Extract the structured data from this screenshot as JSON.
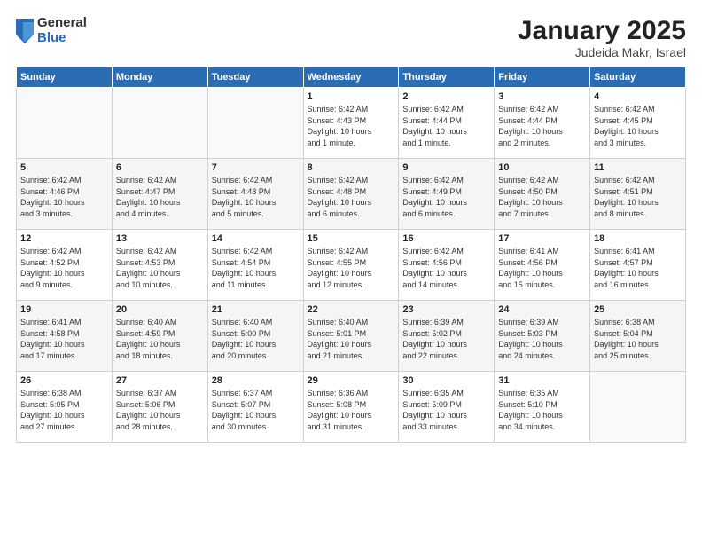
{
  "logo": {
    "general": "General",
    "blue": "Blue"
  },
  "title": "January 2025",
  "subtitle": "Judeida Makr, Israel",
  "weekdays": [
    "Sunday",
    "Monday",
    "Tuesday",
    "Wednesday",
    "Thursday",
    "Friday",
    "Saturday"
  ],
  "weeks": [
    [
      {
        "day": "",
        "info": ""
      },
      {
        "day": "",
        "info": ""
      },
      {
        "day": "",
        "info": ""
      },
      {
        "day": "1",
        "info": "Sunrise: 6:42 AM\nSunset: 4:43 PM\nDaylight: 10 hours\nand 1 minute."
      },
      {
        "day": "2",
        "info": "Sunrise: 6:42 AM\nSunset: 4:44 PM\nDaylight: 10 hours\nand 1 minute."
      },
      {
        "day": "3",
        "info": "Sunrise: 6:42 AM\nSunset: 4:44 PM\nDaylight: 10 hours\nand 2 minutes."
      },
      {
        "day": "4",
        "info": "Sunrise: 6:42 AM\nSunset: 4:45 PM\nDaylight: 10 hours\nand 3 minutes."
      }
    ],
    [
      {
        "day": "5",
        "info": "Sunrise: 6:42 AM\nSunset: 4:46 PM\nDaylight: 10 hours\nand 3 minutes."
      },
      {
        "day": "6",
        "info": "Sunrise: 6:42 AM\nSunset: 4:47 PM\nDaylight: 10 hours\nand 4 minutes."
      },
      {
        "day": "7",
        "info": "Sunrise: 6:42 AM\nSunset: 4:48 PM\nDaylight: 10 hours\nand 5 minutes."
      },
      {
        "day": "8",
        "info": "Sunrise: 6:42 AM\nSunset: 4:48 PM\nDaylight: 10 hours\nand 6 minutes."
      },
      {
        "day": "9",
        "info": "Sunrise: 6:42 AM\nSunset: 4:49 PM\nDaylight: 10 hours\nand 6 minutes."
      },
      {
        "day": "10",
        "info": "Sunrise: 6:42 AM\nSunset: 4:50 PM\nDaylight: 10 hours\nand 7 minutes."
      },
      {
        "day": "11",
        "info": "Sunrise: 6:42 AM\nSunset: 4:51 PM\nDaylight: 10 hours\nand 8 minutes."
      }
    ],
    [
      {
        "day": "12",
        "info": "Sunrise: 6:42 AM\nSunset: 4:52 PM\nDaylight: 10 hours\nand 9 minutes."
      },
      {
        "day": "13",
        "info": "Sunrise: 6:42 AM\nSunset: 4:53 PM\nDaylight: 10 hours\nand 10 minutes."
      },
      {
        "day": "14",
        "info": "Sunrise: 6:42 AM\nSunset: 4:54 PM\nDaylight: 10 hours\nand 11 minutes."
      },
      {
        "day": "15",
        "info": "Sunrise: 6:42 AM\nSunset: 4:55 PM\nDaylight: 10 hours\nand 12 minutes."
      },
      {
        "day": "16",
        "info": "Sunrise: 6:42 AM\nSunset: 4:56 PM\nDaylight: 10 hours\nand 14 minutes."
      },
      {
        "day": "17",
        "info": "Sunrise: 6:41 AM\nSunset: 4:56 PM\nDaylight: 10 hours\nand 15 minutes."
      },
      {
        "day": "18",
        "info": "Sunrise: 6:41 AM\nSunset: 4:57 PM\nDaylight: 10 hours\nand 16 minutes."
      }
    ],
    [
      {
        "day": "19",
        "info": "Sunrise: 6:41 AM\nSunset: 4:58 PM\nDaylight: 10 hours\nand 17 minutes."
      },
      {
        "day": "20",
        "info": "Sunrise: 6:40 AM\nSunset: 4:59 PM\nDaylight: 10 hours\nand 18 minutes."
      },
      {
        "day": "21",
        "info": "Sunrise: 6:40 AM\nSunset: 5:00 PM\nDaylight: 10 hours\nand 20 minutes."
      },
      {
        "day": "22",
        "info": "Sunrise: 6:40 AM\nSunset: 5:01 PM\nDaylight: 10 hours\nand 21 minutes."
      },
      {
        "day": "23",
        "info": "Sunrise: 6:39 AM\nSunset: 5:02 PM\nDaylight: 10 hours\nand 22 minutes."
      },
      {
        "day": "24",
        "info": "Sunrise: 6:39 AM\nSunset: 5:03 PM\nDaylight: 10 hours\nand 24 minutes."
      },
      {
        "day": "25",
        "info": "Sunrise: 6:38 AM\nSunset: 5:04 PM\nDaylight: 10 hours\nand 25 minutes."
      }
    ],
    [
      {
        "day": "26",
        "info": "Sunrise: 6:38 AM\nSunset: 5:05 PM\nDaylight: 10 hours\nand 27 minutes."
      },
      {
        "day": "27",
        "info": "Sunrise: 6:37 AM\nSunset: 5:06 PM\nDaylight: 10 hours\nand 28 minutes."
      },
      {
        "day": "28",
        "info": "Sunrise: 6:37 AM\nSunset: 5:07 PM\nDaylight: 10 hours\nand 30 minutes."
      },
      {
        "day": "29",
        "info": "Sunrise: 6:36 AM\nSunset: 5:08 PM\nDaylight: 10 hours\nand 31 minutes."
      },
      {
        "day": "30",
        "info": "Sunrise: 6:35 AM\nSunset: 5:09 PM\nDaylight: 10 hours\nand 33 minutes."
      },
      {
        "day": "31",
        "info": "Sunrise: 6:35 AM\nSunset: 5:10 PM\nDaylight: 10 hours\nand 34 minutes."
      },
      {
        "day": "",
        "info": ""
      }
    ]
  ]
}
